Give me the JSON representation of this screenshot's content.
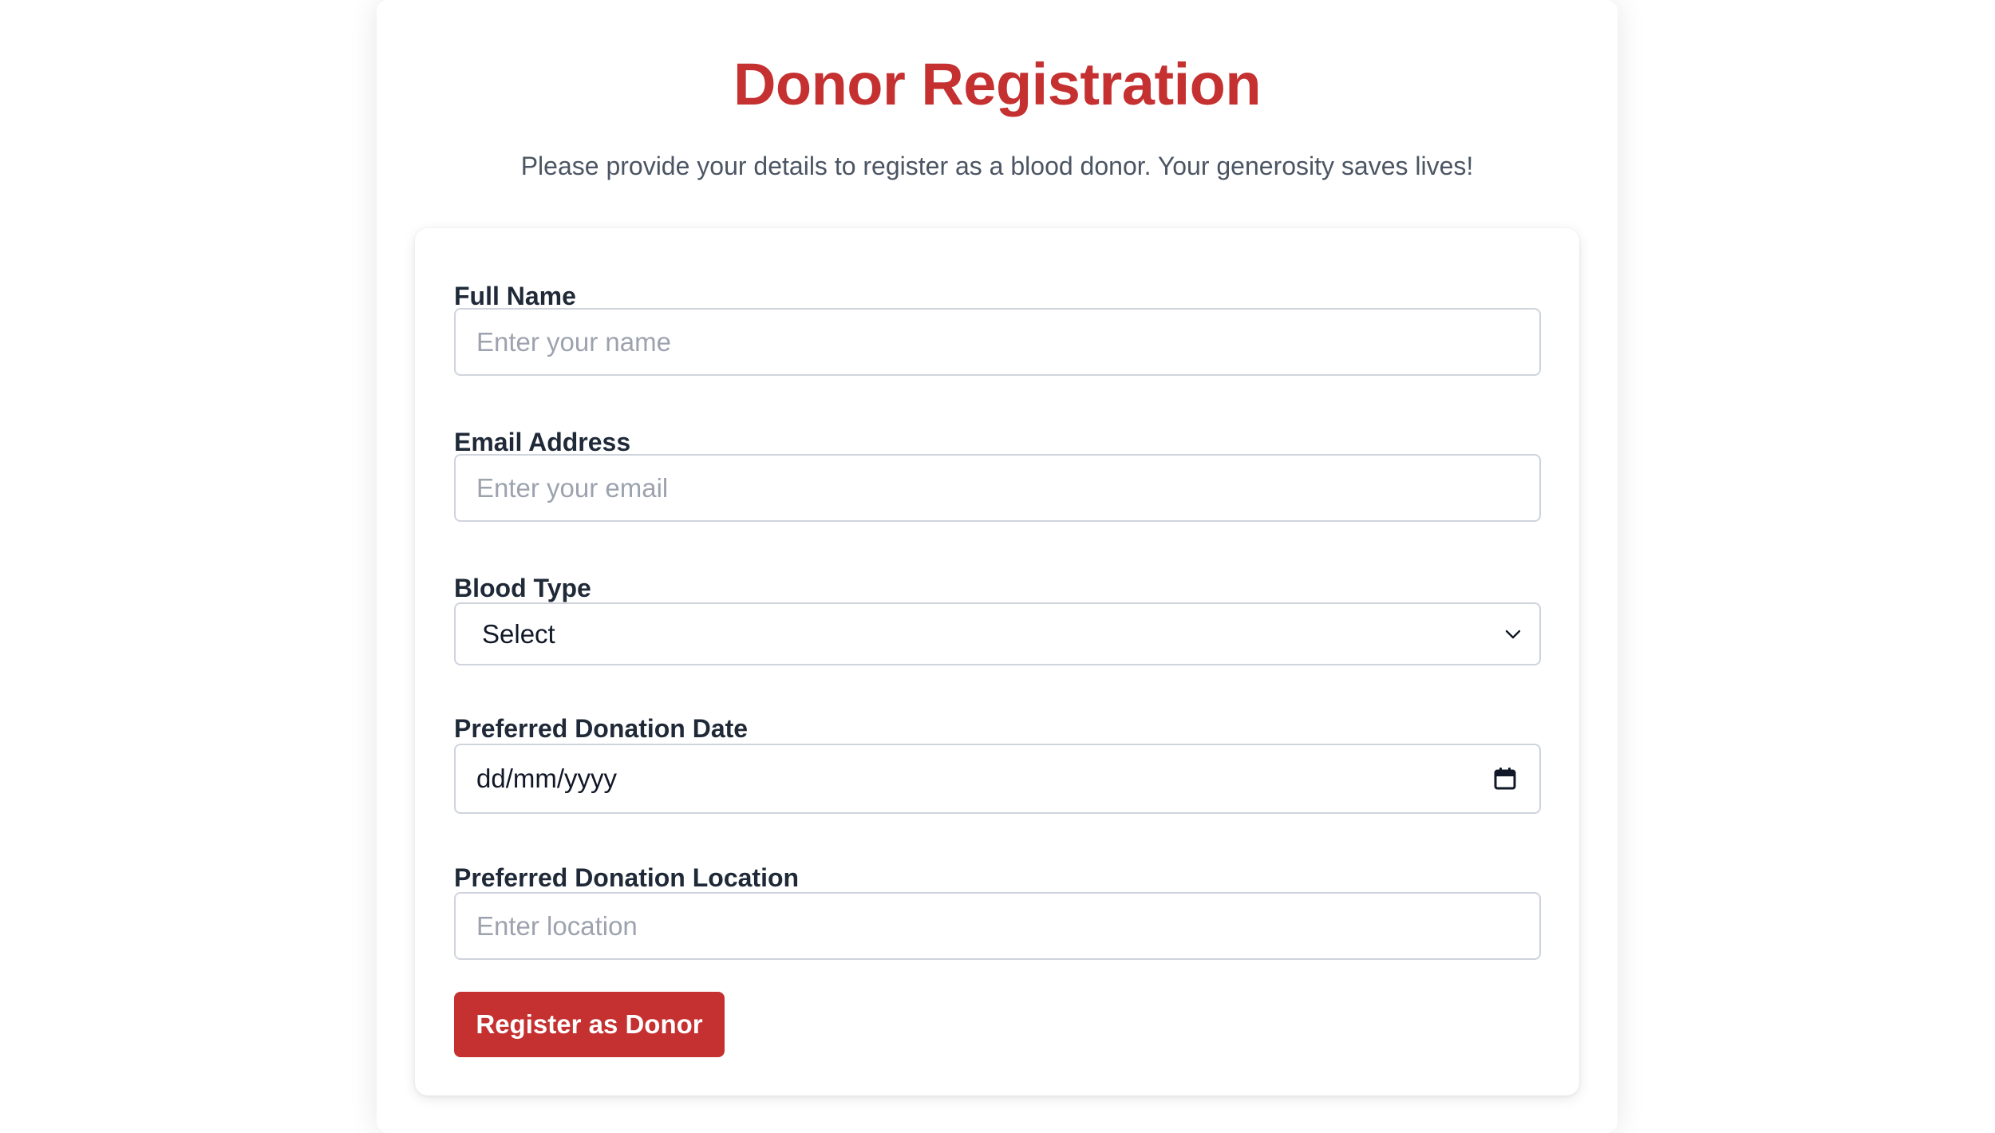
{
  "page": {
    "title": "Donor Registration",
    "subtitle": "Please provide your details to register as a blood donor. Your generosity saves lives!"
  },
  "form": {
    "full_name": {
      "label": "Full Name",
      "placeholder": "Enter your name",
      "value": ""
    },
    "email": {
      "label": "Email Address",
      "placeholder": "Enter your email",
      "value": ""
    },
    "blood_type": {
      "label": "Blood Type",
      "selected": "Select",
      "icon": "chevron-down-icon"
    },
    "donation_date": {
      "label": "Preferred Donation Date",
      "value": "dd/mm/yyyy",
      "icon": "calendar-icon"
    },
    "donation_location": {
      "label": "Preferred Donation Location",
      "placeholder": "Enter location",
      "value": ""
    },
    "submit_label": "Register as Donor"
  },
  "colors": {
    "accent": "#c53030",
    "text": "#1f2937",
    "muted": "#4b5563",
    "placeholder": "#9ca3af",
    "border": "#cfd4dc",
    "background": "#ffffff"
  }
}
